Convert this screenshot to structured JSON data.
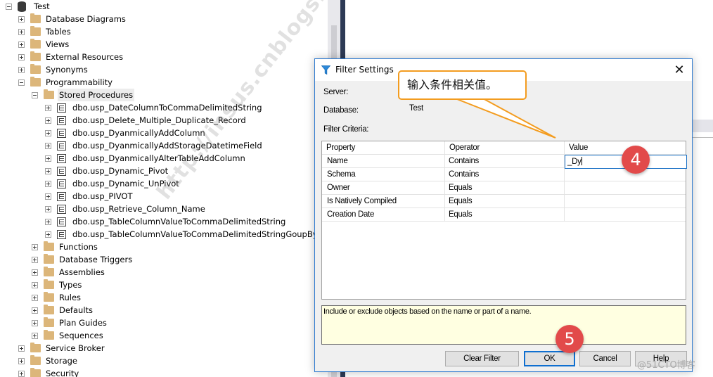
{
  "tree": {
    "root": {
      "label": "Test",
      "icon": "database-icon",
      "expanded": true
    },
    "nodes": [
      {
        "label": "Database Diagrams",
        "level": 1,
        "icon": "folder-icon",
        "toggle": "plus"
      },
      {
        "label": "Tables",
        "level": 1,
        "icon": "folder-icon",
        "toggle": "plus"
      },
      {
        "label": "Views",
        "level": 1,
        "icon": "folder-icon",
        "toggle": "plus"
      },
      {
        "label": "External Resources",
        "level": 1,
        "icon": "folder-icon",
        "toggle": "plus"
      },
      {
        "label": "Synonyms",
        "level": 1,
        "icon": "folder-icon",
        "toggle": "plus"
      },
      {
        "label": "Programmability",
        "level": 1,
        "icon": "folder-icon",
        "toggle": "minus"
      },
      {
        "label": "Stored Procedures",
        "level": 2,
        "icon": "folder-icon",
        "toggle": "minus",
        "selected": true
      },
      {
        "label": "dbo.usp_DateColumnToCommaDelimitedString",
        "level": 3,
        "icon": "stored-procedure-icon",
        "toggle": "plus"
      },
      {
        "label": "dbo.usp_Delete_Multiple_Duplicate_Record",
        "level": 3,
        "icon": "stored-procedure-icon",
        "toggle": "plus"
      },
      {
        "label": "dbo.usp_DyanmicallyAddColumn",
        "level": 3,
        "icon": "stored-procedure-icon",
        "toggle": "plus"
      },
      {
        "label": "dbo.usp_DyanmicallyAddStorageDatetimeField",
        "level": 3,
        "icon": "stored-procedure-icon",
        "toggle": "plus"
      },
      {
        "label": "dbo.usp_DyanmicallyAlterTableAddColumn",
        "level": 3,
        "icon": "stored-procedure-icon",
        "toggle": "plus"
      },
      {
        "label": "dbo.usp_Dynamic_Pivot",
        "level": 3,
        "icon": "stored-procedure-icon",
        "toggle": "plus"
      },
      {
        "label": "dbo.usp_Dynamic_UnPivot",
        "level": 3,
        "icon": "stored-procedure-icon",
        "toggle": "plus"
      },
      {
        "label": "dbo.usp_PIVOT",
        "level": 3,
        "icon": "stored-procedure-icon",
        "toggle": "plus"
      },
      {
        "label": "dbo.usp_Retrieve_Column_Name",
        "level": 3,
        "icon": "stored-procedure-icon",
        "toggle": "plus"
      },
      {
        "label": "dbo.usp_TableColumnValueToCommaDelimitedString",
        "level": 3,
        "icon": "stored-procedure-icon",
        "toggle": "plus"
      },
      {
        "label": "dbo.usp_TableColumnValueToCommaDelimitedStringGoupBy",
        "level": 3,
        "icon": "stored-procedure-icon",
        "toggle": "plus"
      },
      {
        "label": "Functions",
        "level": 2,
        "icon": "folder-icon",
        "toggle": "plus"
      },
      {
        "label": "Database Triggers",
        "level": 2,
        "icon": "folder-icon",
        "toggle": "plus"
      },
      {
        "label": "Assemblies",
        "level": 2,
        "icon": "folder-icon",
        "toggle": "plus"
      },
      {
        "label": "Types",
        "level": 2,
        "icon": "folder-icon",
        "toggle": "plus"
      },
      {
        "label": "Rules",
        "level": 2,
        "icon": "folder-icon",
        "toggle": "plus"
      },
      {
        "label": "Defaults",
        "level": 2,
        "icon": "folder-icon",
        "toggle": "plus"
      },
      {
        "label": "Plan Guides",
        "level": 2,
        "icon": "folder-icon",
        "toggle": "plus"
      },
      {
        "label": "Sequences",
        "level": 2,
        "icon": "folder-icon",
        "toggle": "plus"
      },
      {
        "label": "Service Broker",
        "level": 1,
        "icon": "folder-icon",
        "toggle": "plus"
      },
      {
        "label": "Storage",
        "level": 1,
        "icon": "folder-icon",
        "toggle": "plus"
      },
      {
        "label": "Security",
        "level": 1,
        "icon": "folder-icon",
        "toggle": "plus"
      }
    ]
  },
  "dialog": {
    "title": "Filter Settings",
    "title_icon": "filter-funnel-icon",
    "close_glyph": "✕",
    "server_label": "Server:",
    "server_value": "",
    "database_label": "Database:",
    "database_value": "Test",
    "criteria_label": "Filter Criteria:",
    "grid": {
      "columns": [
        "Property",
        "Operator",
        "Value"
      ],
      "rows": [
        {
          "property": "Name",
          "operator": "Contains",
          "value": "_Dy"
        },
        {
          "property": "Schema",
          "operator": "Contains",
          "value": ""
        },
        {
          "property": "Owner",
          "operator": "Equals",
          "value": ""
        },
        {
          "property": "Is Natively Compiled",
          "operator": "Equals",
          "value": ""
        },
        {
          "property": "Creation Date",
          "operator": "Equals",
          "value": ""
        }
      ]
    },
    "description": "Include or exclude objects based on the name or part of a name.",
    "buttons": {
      "clear_filter": "Clear Filter",
      "ok": "OK",
      "cancel": "Cancel",
      "help": "Help"
    }
  },
  "annotations": {
    "callout_text": "输入条件相关值。",
    "callout_color": "#f39c1f",
    "badge_color": "#e24a4a",
    "step4": "4",
    "step5": "5"
  },
  "watermarks": {
    "diagonal": "http://insus.cnblogs.com",
    "corner": "@51CTO博客"
  }
}
